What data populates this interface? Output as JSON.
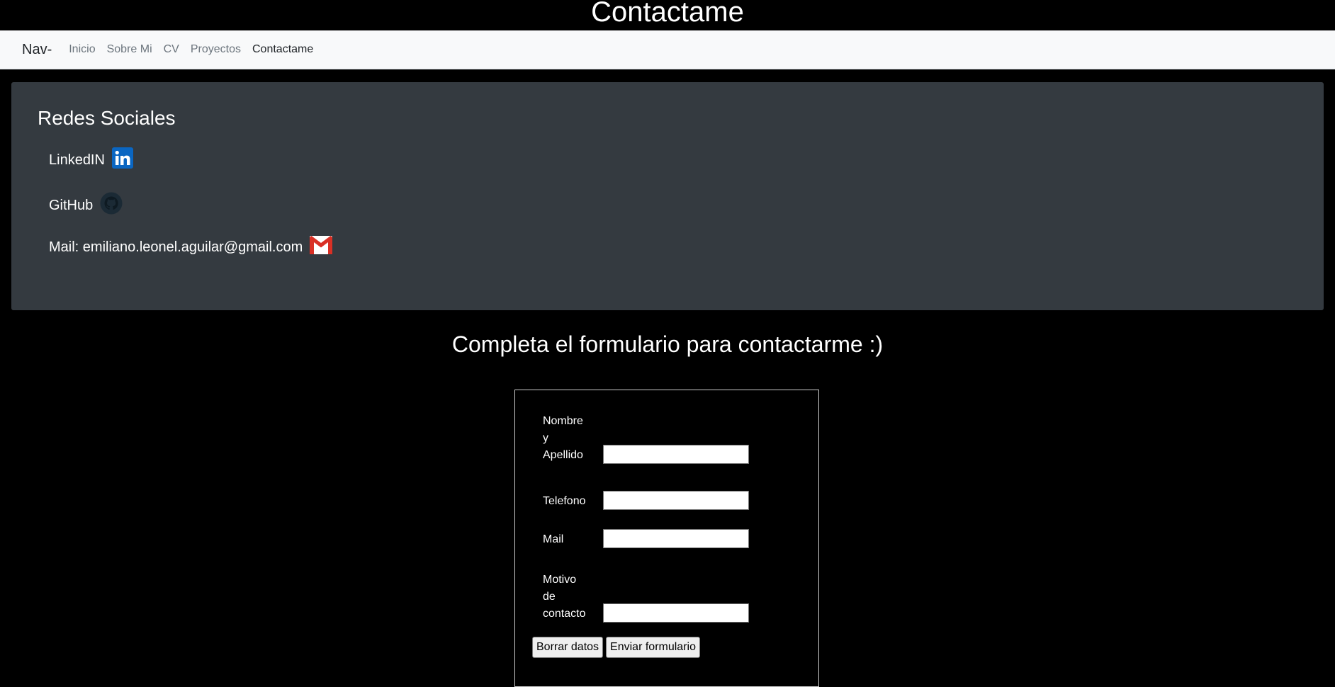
{
  "header": {
    "title": "Contactame"
  },
  "navbar": {
    "brand": "Nav-",
    "links": [
      "Inicio",
      "Sobre Mi",
      "CV",
      "Proyectos",
      "Contactame"
    ]
  },
  "social": {
    "title": "Redes Sociales",
    "linkedin": {
      "label": "LinkedIN",
      "icon": "linkedin-icon",
      "color": "#0a66c2"
    },
    "github": {
      "label": "GitHub",
      "icon": "github-icon",
      "color": "#1b2a35"
    },
    "mail": {
      "label": "Mail: emiliano.leonel.aguilar@gmail.com",
      "icon": "gmail-icon",
      "color": "#d93025"
    }
  },
  "form": {
    "title": "Completa el formulario para contactarme :)",
    "fields": {
      "name_label": [
        "Nombre",
        "y",
        "Apellido"
      ],
      "phone_label": "Telefono",
      "mail_label": "Mail",
      "reason_label": [
        "Motivo",
        "de",
        "contacto"
      ]
    },
    "values": {
      "name": "",
      "phone": "",
      "mail": "",
      "reason": ""
    },
    "buttons": {
      "reset": "Borrar datos",
      "submit": "Enviar formulario"
    }
  },
  "colors": {
    "background": "#000000",
    "navbar": "#f8f9fa",
    "panel": "#343a40"
  }
}
